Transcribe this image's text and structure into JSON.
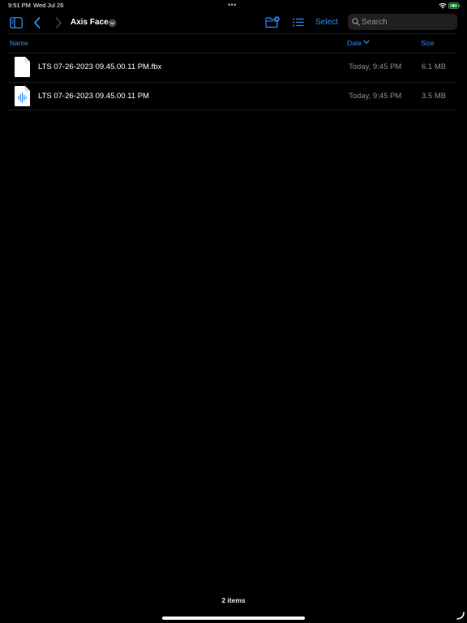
{
  "status_bar": {
    "time": "9:51 PM",
    "date": "Wed Jul 26",
    "multitasking_dots": "•••",
    "wifi_icon": "wifi-icon",
    "battery_icon": "battery-charging-icon"
  },
  "toolbar": {
    "sidebar_icon": "sidebar-icon",
    "back_icon": "chevron-left-icon",
    "forward_icon": "chevron-right-icon",
    "folder_title": "Axis Face",
    "title_menu_icon": "chevron-down-circle-icon",
    "new_folder_icon": "folder-badge-plus-icon",
    "view_options_icon": "list-icon",
    "select_label": "Select",
    "search": {
      "placeholder": "Search",
      "value": ""
    }
  },
  "columns": {
    "name": "Name",
    "date": "Date",
    "size": "Size",
    "sort_column": "date",
    "sort_direction": "descending"
  },
  "files": [
    {
      "name": "LTS 07-26-2023 09.45.00.11 PM.fbx",
      "date": "Today, 9:45 PM",
      "size": "6.1 MB",
      "icon": "document-icon"
    },
    {
      "name": "LTS 07-26-2023 09.45.00.11 PM",
      "date": "Today, 9:45 PM",
      "size": "3.5 MB",
      "icon": "audio-file-icon"
    }
  ],
  "footer": {
    "item_count": "2 items"
  },
  "colors": {
    "accent": "#2e8bff",
    "background": "#000000",
    "secondary_text": "#8d8d92",
    "search_field": "#1f1f21",
    "battery": "#34c759"
  }
}
